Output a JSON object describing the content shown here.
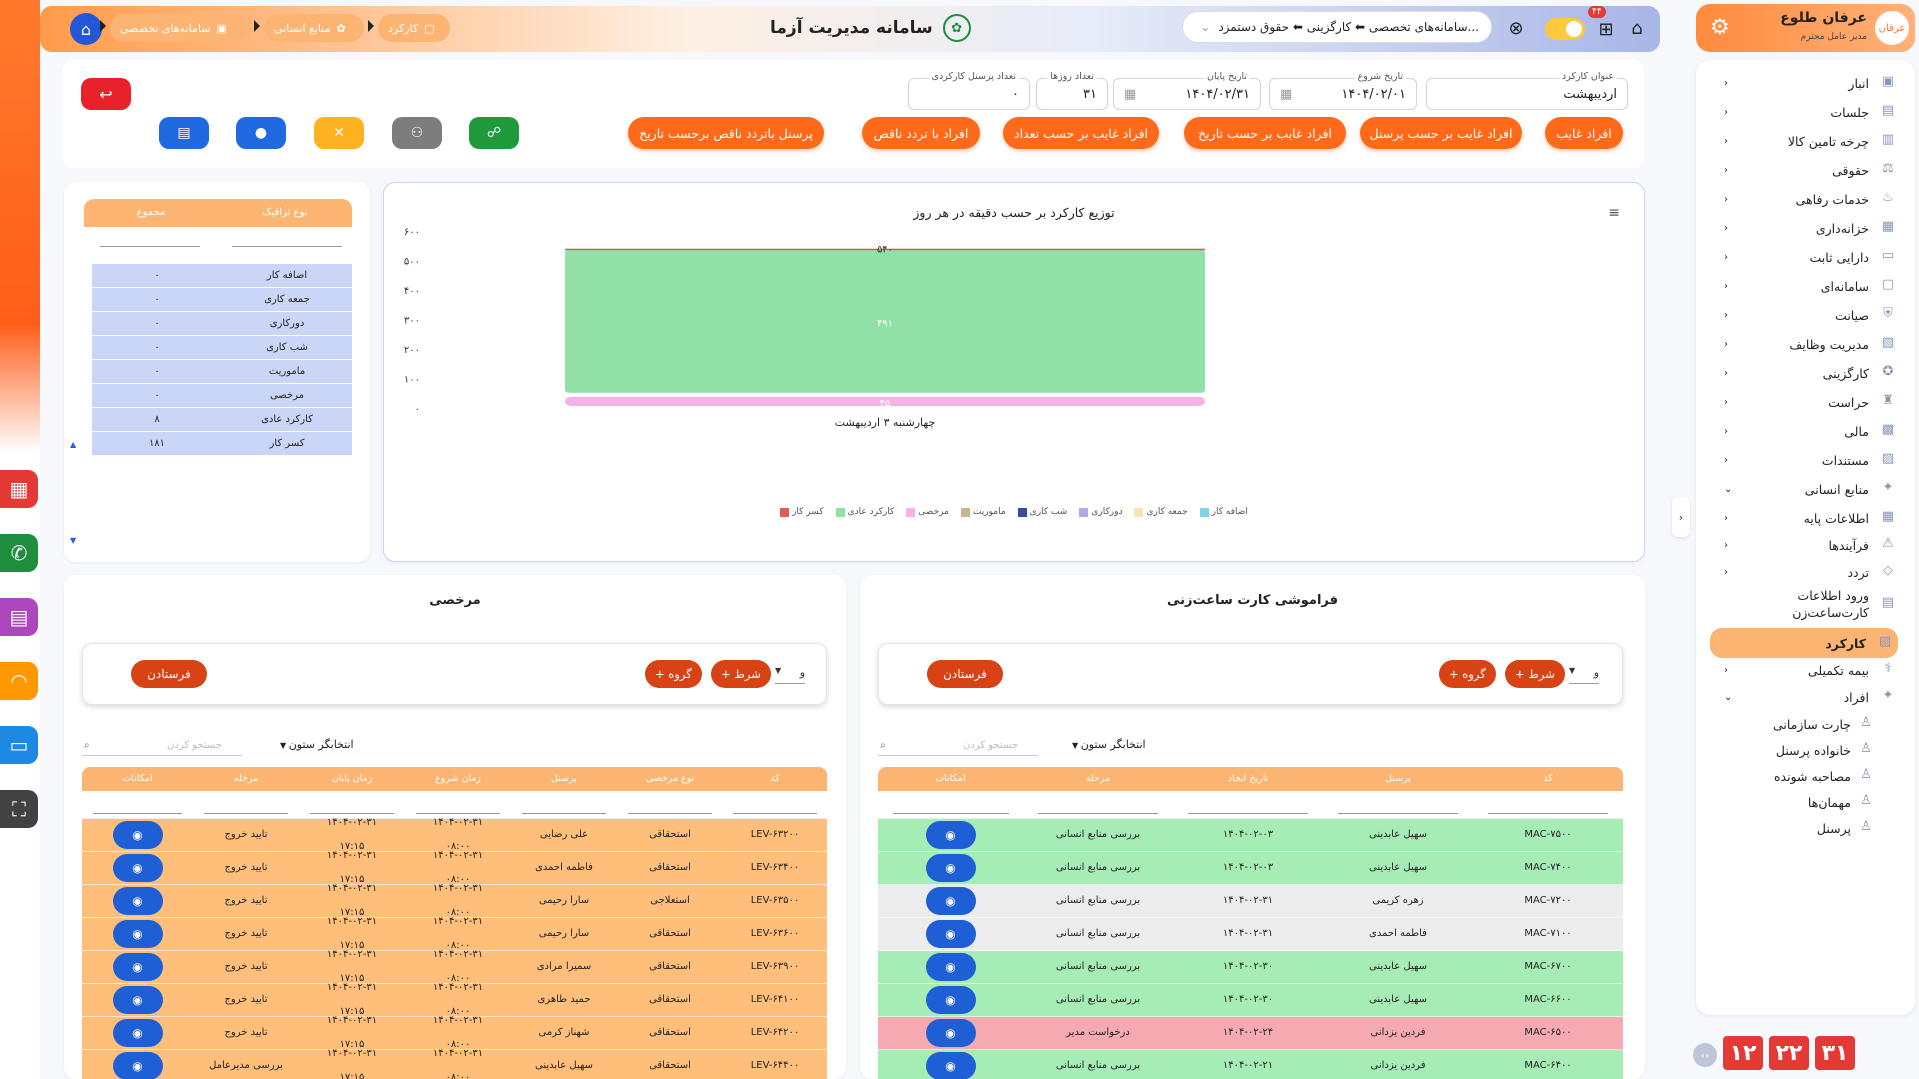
{
  "header": {
    "title": "سامانه مدیریت آزما",
    "breadcrumbs": [
      "سامانه‌های تخصصی",
      "منابع انسانی",
      "کارکرد"
    ],
    "search_text": "سامانه‌های تخصصی ⬅ کارگزینی ⬅ حقوق دستمزد...",
    "notification_count": "۴۴"
  },
  "user": {
    "name": "عرفان طلوع",
    "role": "مدیر عامل محترم",
    "avatar_text": "عرفان"
  },
  "sidebar": {
    "items": [
      {
        "label": "انبار",
        "icon": "warehouse-icon",
        "chevron": "›"
      },
      {
        "label": "جلسات",
        "icon": "meeting-icon",
        "chevron": "›"
      },
      {
        "label": "چرخه تامین کالا",
        "icon": "supply-icon",
        "chevron": "›"
      },
      {
        "label": "حقوقی",
        "icon": "legal-icon",
        "chevron": "›"
      },
      {
        "label": "خدمات رفاهی",
        "icon": "welfare-icon",
        "chevron": "›"
      },
      {
        "label": "خزانه‌داری",
        "icon": "treasury-icon",
        "chevron": "›"
      },
      {
        "label": "دارایی ثابت",
        "icon": "asset-icon",
        "chevron": "›"
      },
      {
        "label": "سامانه‌ای",
        "icon": "system-icon",
        "chevron": "›"
      },
      {
        "label": "صیانت",
        "icon": "shield-icon",
        "chevron": "›"
      },
      {
        "label": "مدیریت وظایف",
        "icon": "tasks-icon",
        "chevron": "›"
      },
      {
        "label": "کارگزینی",
        "icon": "staff-icon",
        "chevron": "›"
      },
      {
        "label": "حراست",
        "icon": "security-icon",
        "chevron": "›"
      },
      {
        "label": "مالی",
        "icon": "finance-icon",
        "chevron": "›"
      },
      {
        "label": "مستندات",
        "icon": "docs-icon",
        "chevron": "›"
      },
      {
        "label": "منابع انسانی",
        "icon": "hr-icon",
        "chevron": "⌄"
      }
    ],
    "hr_sub": [
      {
        "label": "اطلاعات پایه",
        "chevron": "›"
      },
      {
        "label": "فرآیندها",
        "chevron": "›"
      },
      {
        "label": "تردد",
        "chevron": "›"
      },
      {
        "label": "ورود اطلاعات",
        "label2": "کارت‌ساعت‌زن",
        "chevron": ""
      },
      {
        "label": "کارکرد",
        "chevron": ""
      },
      {
        "label": "بیمه تکمیلی",
        "chevron": "›"
      },
      {
        "label": "افراد",
        "chevron": "⌄"
      }
    ],
    "people_sub": [
      "چارت سازمانی",
      "خانواده پرسنل",
      "مصاحبه شونده",
      "مهمان‌ها",
      "پرسنل"
    ],
    "date": [
      "۳۱",
      "۲۲",
      "۱۲"
    ]
  },
  "filters": {
    "title_label": "عنوان کارکرد",
    "title_value": "اردیبهشت",
    "start_label": "تاریخ شروع",
    "start_value": "۱۴۰۴/۰۲/۰۱",
    "end_label": "تاریخ پایان",
    "end_value": "۱۴۰۴/۰۲/۳۱",
    "days_label": "تعداد روزها",
    "days_value": "۳۱",
    "staff_label": "تعداد پرسنل کارکردی",
    "staff_value": "۰",
    "buttons": [
      "افراد غایب",
      "افراد غایب بر حسب پرسنل",
      "افراد غایب بر حسب تاریخ",
      "افراد غایب بر حسب تعداد",
      "افراد با تردد ناقص",
      "پرسنل باتردد ناقص برحسب تاریخ"
    ]
  },
  "traffic_table": {
    "headers": [
      "نوع ترافیک",
      "مجموع"
    ],
    "rows": [
      [
        "اضافه کار",
        "۰"
      ],
      [
        "جمعه کاری",
        "۰"
      ],
      [
        "دورکاری",
        "۰"
      ],
      [
        "شب کاری",
        "۰"
      ],
      [
        "ماموریت",
        "۰"
      ],
      [
        "مرخصی",
        "۰"
      ],
      [
        "کارکرد عادی",
        "۸"
      ],
      [
        "کسر کار",
        "۱۸۱"
      ]
    ]
  },
  "chart_data": {
    "type": "bar",
    "title": "توزیع کارکرد بر حسب دقیقه در هر روز",
    "categories": [
      "چهارشنبه ۳ اردیبهشت"
    ],
    "ylim": [
      0,
      600
    ],
    "yticks": [
      "۰",
      "۱۰۰",
      "۲۰۰",
      "۳۰۰",
      "۴۰۰",
      "۵۰۰",
      "۶۰۰"
    ],
    "series": [
      {
        "name": "اضافه کار",
        "values": [
          0
        ],
        "color": "#7fd3e6"
      },
      {
        "name": "جمعه کاری",
        "values": [
          0
        ],
        "color": "#f6e3b0"
      },
      {
        "name": "دورکاری",
        "values": [
          0
        ],
        "color": "#b8a8e8"
      },
      {
        "name": "شب کاری",
        "values": [
          0
        ],
        "color": "#3a4aa6"
      },
      {
        "name": "ماموریت",
        "values": [
          0
        ],
        "color": "#c9b38e"
      },
      {
        "name": "مرخصی",
        "values": [
          45
        ],
        "color": "#f5b2e6"
      },
      {
        "name": "کارکرد عادی",
        "values": [
          491
        ],
        "color": "#91e0a8"
      },
      {
        "name": "کسر کار",
        "values": [
          4
        ],
        "color": "#e05a5a"
      }
    ],
    "labels": {
      "bottom": "۴۵",
      "middle": "۴۹۱",
      "top": "۵۴۰"
    }
  },
  "leave_panel": {
    "title": "مرخصی",
    "send_label": "فرستادن",
    "condition_label": "+ شرط",
    "group_label": "+ گروه",
    "logic_value": "و",
    "column_picker": "انتخابگر ستون",
    "search_placeholder": "جستجو کردن",
    "headers": [
      "کد",
      "نوع مرخصی",
      "پرسنل",
      "زمان شروع",
      "زمان پایان",
      "مرحله",
      "امکانات"
    ],
    "rows": [
      {
        "code": "LEV-۶۳۲۰۰",
        "type": "استحقاقی",
        "person": "علی رضایی",
        "start1": "۱۴۰۴-۰۲-۳۱",
        "start2": "۰۸:۰۰",
        "end1": "۱۴۰۴-۰۲-۳۱",
        "end2": "۱۷:۱۵",
        "stage": "تایید خروج"
      },
      {
        "code": "LEV-۶۳۴۰۰",
        "type": "استحقاقی",
        "person": "فاطمه احمدی",
        "start1": "۱۴۰۴-۰۲-۳۱",
        "start2": "۰۸:۰۰",
        "end1": "۱۴۰۴-۰۲-۳۱",
        "end2": "۱۷:۱۵",
        "stage": "تایید خروج"
      },
      {
        "code": "LEV-۶۳۵۰۰",
        "type": "استعلاجی",
        "person": "سارا رحیمی",
        "start1": "۱۴۰۴-۰۲-۳۱",
        "start2": "۰۸:۰۰",
        "end1": "۱۴۰۴-۰۲-۳۱",
        "end2": "۱۷:۱۵",
        "stage": "تایید خروج"
      },
      {
        "code": "LEV-۶۳۶۰۰",
        "type": "استحقاقی",
        "person": "سارا رحیمی",
        "start1": "۱۴۰۴-۰۲-۳۱",
        "start2": "۰۸:۰۰",
        "end1": "۱۴۰۴-۰۲-۳۱",
        "end2": "۱۷:۱۵",
        "stage": "تایید خروج"
      },
      {
        "code": "LEV-۶۳۹۰۰",
        "type": "استحقاقی",
        "person": "سمیرا مرادی",
        "start1": "۱۴۰۴-۰۲-۳۱",
        "start2": "۰۸:۰۰",
        "end1": "۱۴۰۴-۰۲-۳۱",
        "end2": "۱۷:۱۵",
        "stage": "تایید خروج"
      },
      {
        "code": "LEV-۶۴۱۰۰",
        "type": "استحقاقی",
        "person": "حمید طاهری",
        "start1": "۱۴۰۴-۰۲-۳۱",
        "start2": "۰۸:۰۰",
        "end1": "۱۴۰۴-۰۲-۳۱",
        "end2": "۱۷:۱۵",
        "stage": "تایید خروج"
      },
      {
        "code": "LEV-۶۴۲۰۰",
        "type": "استحقاقی",
        "person": "شهناز کرمی",
        "start1": "۱۴۰۴-۰۲-۳۱",
        "start2": "۰۸:۰۰",
        "end1": "۱۴۰۴-۰۲-۳۱",
        "end2": "۱۷:۱۵",
        "stage": "تایید خروج"
      },
      {
        "code": "LEV-۶۴۴۰۰",
        "type": "استحقاقی",
        "person": "سهیل عابدینی",
        "start1": "۱۴۰۴-۰۲-۳۱",
        "start2": "۰۸:۰۰",
        "end1": "۱۴۰۴-۰۲-۳۱",
        "end2": "۱۷:۱۵",
        "stage": "بررسی مدیرعامل"
      }
    ]
  },
  "card_panel": {
    "title": "فراموشی کارت ساعت‌زنی",
    "send_label": "فرستادن",
    "condition_label": "+ شرط",
    "group_label": "+ گروه",
    "logic_value": "و",
    "column_picker": "انتخابگر ستون",
    "search_placeholder": "جستجو کردن",
    "headers": [
      "کد",
      "پرسنل",
      "تاریخ ایجاد",
      "مرحله",
      "امکانات"
    ],
    "rows": [
      {
        "code": "MAC-۷۵۰۰",
        "person": "سهیل عابدینی",
        "date": "۱۴۰۴-۰۲-۰۳",
        "stage": "بررسی منابع انسانی",
        "color": "#a6ecb5"
      },
      {
        "code": "MAC-۷۴۰۰",
        "person": "سهیل عابدینی",
        "date": "۱۴۰۴-۰۲-۰۳",
        "stage": "بررسی منابع انسانی",
        "color": "#a6ecb5"
      },
      {
        "code": "MAC-۷۲۰۰",
        "person": "زهره کریمی",
        "date": "۱۴۰۴-۰۲-۳۱",
        "stage": "بررسی منابع انسانی",
        "color": "#ececec"
      },
      {
        "code": "MAC-۷۱۰۰",
        "person": "فاطمه احمدی",
        "date": "۱۴۰۴-۰۲-۳۱",
        "stage": "بررسی منابع انسانی",
        "color": "#ececec"
      },
      {
        "code": "MAC-۶۷۰۰",
        "person": "سهیل عابدینی",
        "date": "۱۴۰۴-۰۲-۳۰",
        "stage": "بررسی منابع انسانی",
        "color": "#a6ecb5"
      },
      {
        "code": "MAC-۶۶۰۰",
        "person": "سهیل عابدینی",
        "date": "۱۴۰۴-۰۲-۳۰",
        "stage": "بررسی منابع انسانی",
        "color": "#a6ecb5"
      },
      {
        "code": "MAC-۶۵۰۰",
        "person": "فردین یزدانی",
        "date": "۱۴۰۴-۰۲-۲۴",
        "stage": "درخواست مدیر",
        "color": "#f5a9b0"
      },
      {
        "code": "MAC-۶۴۰۰",
        "person": "فردین یزدانی",
        "date": "۱۴۰۴-۰۲-۲۱",
        "stage": "بررسی منابع انسانی",
        "color": "#a6ecb5"
      }
    ]
  },
  "colors": {
    "accent": "#ff6a1a",
    "primary": "#1f5fd6",
    "header_orange": "#fbb472",
    "leave_row": "#ffbf7a"
  }
}
